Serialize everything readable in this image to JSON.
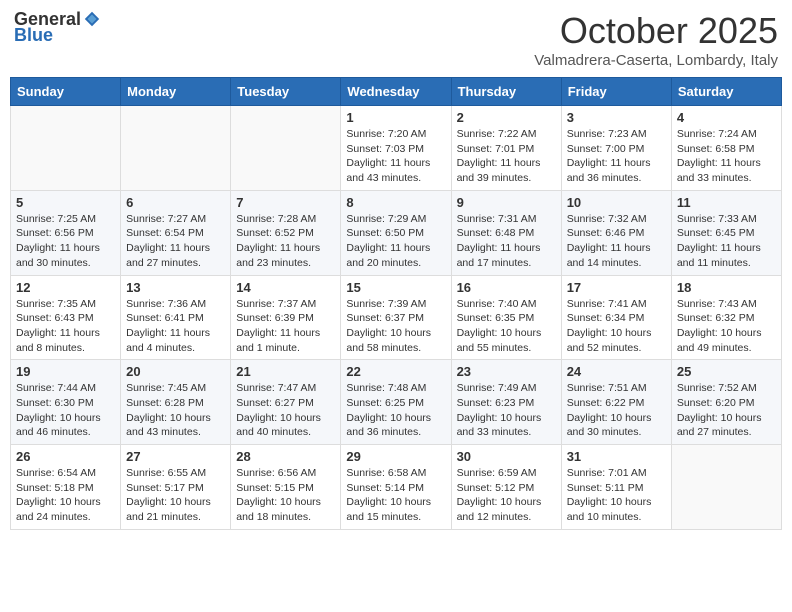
{
  "header": {
    "logo_general": "General",
    "logo_blue": "Blue",
    "month": "October 2025",
    "location": "Valmadrera-Caserta, Lombardy, Italy"
  },
  "days_of_week": [
    "Sunday",
    "Monday",
    "Tuesday",
    "Wednesday",
    "Thursday",
    "Friday",
    "Saturday"
  ],
  "weeks": [
    [
      {
        "day": "",
        "empty": true
      },
      {
        "day": "",
        "empty": true
      },
      {
        "day": "",
        "empty": true
      },
      {
        "day": "1",
        "sunrise": "7:20 AM",
        "sunset": "7:03 PM",
        "daylight": "11 hours and 43 minutes."
      },
      {
        "day": "2",
        "sunrise": "7:22 AM",
        "sunset": "7:01 PM",
        "daylight": "11 hours and 39 minutes."
      },
      {
        "day": "3",
        "sunrise": "7:23 AM",
        "sunset": "7:00 PM",
        "daylight": "11 hours and 36 minutes."
      },
      {
        "day": "4",
        "sunrise": "7:24 AM",
        "sunset": "6:58 PM",
        "daylight": "11 hours and 33 minutes."
      }
    ],
    [
      {
        "day": "5",
        "sunrise": "7:25 AM",
        "sunset": "6:56 PM",
        "daylight": "11 hours and 30 minutes."
      },
      {
        "day": "6",
        "sunrise": "7:27 AM",
        "sunset": "6:54 PM",
        "daylight": "11 hours and 27 minutes."
      },
      {
        "day": "7",
        "sunrise": "7:28 AM",
        "sunset": "6:52 PM",
        "daylight": "11 hours and 23 minutes."
      },
      {
        "day": "8",
        "sunrise": "7:29 AM",
        "sunset": "6:50 PM",
        "daylight": "11 hours and 20 minutes."
      },
      {
        "day": "9",
        "sunrise": "7:31 AM",
        "sunset": "6:48 PM",
        "daylight": "11 hours and 17 minutes."
      },
      {
        "day": "10",
        "sunrise": "7:32 AM",
        "sunset": "6:46 PM",
        "daylight": "11 hours and 14 minutes."
      },
      {
        "day": "11",
        "sunrise": "7:33 AM",
        "sunset": "6:45 PM",
        "daylight": "11 hours and 11 minutes."
      }
    ],
    [
      {
        "day": "12",
        "sunrise": "7:35 AM",
        "sunset": "6:43 PM",
        "daylight": "11 hours and 8 minutes."
      },
      {
        "day": "13",
        "sunrise": "7:36 AM",
        "sunset": "6:41 PM",
        "daylight": "11 hours and 4 minutes."
      },
      {
        "day": "14",
        "sunrise": "7:37 AM",
        "sunset": "6:39 PM",
        "daylight": "11 hours and 1 minute."
      },
      {
        "day": "15",
        "sunrise": "7:39 AM",
        "sunset": "6:37 PM",
        "daylight": "10 hours and 58 minutes."
      },
      {
        "day": "16",
        "sunrise": "7:40 AM",
        "sunset": "6:35 PM",
        "daylight": "10 hours and 55 minutes."
      },
      {
        "day": "17",
        "sunrise": "7:41 AM",
        "sunset": "6:34 PM",
        "daylight": "10 hours and 52 minutes."
      },
      {
        "day": "18",
        "sunrise": "7:43 AM",
        "sunset": "6:32 PM",
        "daylight": "10 hours and 49 minutes."
      }
    ],
    [
      {
        "day": "19",
        "sunrise": "7:44 AM",
        "sunset": "6:30 PM",
        "daylight": "10 hours and 46 minutes."
      },
      {
        "day": "20",
        "sunrise": "7:45 AM",
        "sunset": "6:28 PM",
        "daylight": "10 hours and 43 minutes."
      },
      {
        "day": "21",
        "sunrise": "7:47 AM",
        "sunset": "6:27 PM",
        "daylight": "10 hours and 40 minutes."
      },
      {
        "day": "22",
        "sunrise": "7:48 AM",
        "sunset": "6:25 PM",
        "daylight": "10 hours and 36 minutes."
      },
      {
        "day": "23",
        "sunrise": "7:49 AM",
        "sunset": "6:23 PM",
        "daylight": "10 hours and 33 minutes."
      },
      {
        "day": "24",
        "sunrise": "7:51 AM",
        "sunset": "6:22 PM",
        "daylight": "10 hours and 30 minutes."
      },
      {
        "day": "25",
        "sunrise": "7:52 AM",
        "sunset": "6:20 PM",
        "daylight": "10 hours and 27 minutes."
      }
    ],
    [
      {
        "day": "26",
        "sunrise": "6:54 AM",
        "sunset": "5:18 PM",
        "daylight": "10 hours and 24 minutes."
      },
      {
        "day": "27",
        "sunrise": "6:55 AM",
        "sunset": "5:17 PM",
        "daylight": "10 hours and 21 minutes."
      },
      {
        "day": "28",
        "sunrise": "6:56 AM",
        "sunset": "5:15 PM",
        "daylight": "10 hours and 18 minutes."
      },
      {
        "day": "29",
        "sunrise": "6:58 AM",
        "sunset": "5:14 PM",
        "daylight": "10 hours and 15 minutes."
      },
      {
        "day": "30",
        "sunrise": "6:59 AM",
        "sunset": "5:12 PM",
        "daylight": "10 hours and 12 minutes."
      },
      {
        "day": "31",
        "sunrise": "7:01 AM",
        "sunset": "5:11 PM",
        "daylight": "10 hours and 10 minutes."
      },
      {
        "day": "",
        "empty": true
      }
    ]
  ]
}
